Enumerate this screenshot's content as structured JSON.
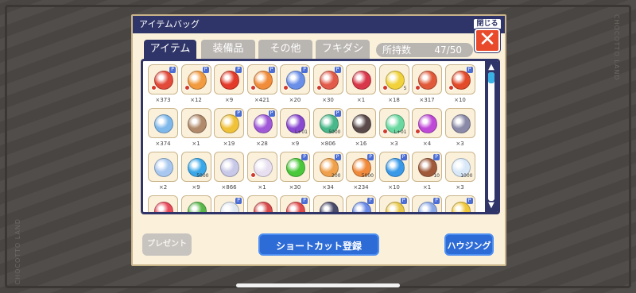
{
  "watermark": "CHOCOTTO LAND",
  "dialog": {
    "title": "アイテムバッグ",
    "close_label": "閉じる",
    "close_symbol": "✕"
  },
  "tabs": [
    {
      "label": "アイテム",
      "active": true
    },
    {
      "label": "装備品",
      "active": false
    },
    {
      "label": "その他",
      "active": false
    },
    {
      "label": "フキダシ",
      "active": false
    }
  ],
  "capacity": {
    "label": "所持数",
    "value": "47/50"
  },
  "scroll": {
    "up": "▲",
    "down": "▼"
  },
  "items": [
    {
      "icon": "red-potion-icon",
      "color": "#e24a3a",
      "qty": "×373",
      "badge": true,
      "minus": true
    },
    {
      "icon": "orange-potion-icon",
      "color": "#f19a3e",
      "qty": "×12",
      "badge": true,
      "minus": true
    },
    {
      "icon": "red-orb-icon",
      "color": "#e33a2a",
      "qty": "×9",
      "badge": true,
      "minus": false
    },
    {
      "icon": "orange-potion-icon",
      "color": "#f08c3a",
      "qty": "×421",
      "badge": true,
      "minus": true
    },
    {
      "icon": "blue-star-potion-icon",
      "color": "#6a8fe8",
      "qty": "×20",
      "badge": true,
      "minus": true
    },
    {
      "icon": "red-potion-icon",
      "color": "#e25a4a",
      "qty": "×30",
      "badge": true,
      "minus": true
    },
    {
      "icon": "red-capsule-icon",
      "color": "#d9384a",
      "qty": "×1",
      "badge": false,
      "minus": false
    },
    {
      "icon": "gold-star-icon",
      "color": "#f1d23a",
      "qty": "×18",
      "badge": false,
      "minus": true,
      "inlabel": "5"
    },
    {
      "icon": "red-bottle-icon",
      "color": "#e05a3a",
      "qty": "×317",
      "badge": false,
      "minus": true
    },
    {
      "icon": "red-orb-icon",
      "color": "#e34a2a",
      "qty": "×10",
      "badge": true,
      "minus": true
    },
    {
      "icon": "blue-crystal-icon",
      "color": "#7fb8ea",
      "qty": "×374",
      "badge": false,
      "minus": false
    },
    {
      "icon": "hammer-icon",
      "color": "#b08a6a",
      "qty": "×1",
      "badge": false,
      "minus": false
    },
    {
      "icon": "gold-orb-icon",
      "color": "#f0c23a",
      "qty": "×19",
      "badge": true,
      "minus": false
    },
    {
      "icon": "purple-orb-icon",
      "color": "#a05ad8",
      "qty": "×28",
      "badge": true,
      "minus": false
    },
    {
      "icon": "purple-gem-icon",
      "color": "#8a4ad0",
      "qty": "×9",
      "badge": false,
      "minus": false,
      "inlabel": "L+01"
    },
    {
      "icon": "green-bottle-icon",
      "color": "#4ab88a",
      "qty": "×806",
      "badge": true,
      "minus": false,
      "inlabel": "5000"
    },
    {
      "icon": "love-heart-icon",
      "color": "#5a4a4a",
      "qty": "×16",
      "badge": false,
      "minus": false
    },
    {
      "icon": "green-moon-icon",
      "color": "#6ad8a0",
      "qty": "×3",
      "badge": false,
      "minus": true,
      "inlabel": "L+01"
    },
    {
      "icon": "rainbow-book-icon",
      "color": "#c04ad8",
      "qty": "×4",
      "badge": false,
      "minus": true
    },
    {
      "icon": "gray-dice-icon",
      "color": "#8a8aa8",
      "qty": "×3",
      "badge": false,
      "minus": false
    },
    {
      "icon": "hp-egg-icon",
      "color": "#a8c8f0",
      "qty": "×2",
      "badge": false,
      "minus": false
    },
    {
      "icon": "blue-drink-icon",
      "color": "#3aa8e8",
      "qty": "×9",
      "badge": false,
      "minus": false,
      "inlabel": "5000"
    },
    {
      "icon": "white-wing-icon",
      "color": "#c8c8e8",
      "qty": "×866",
      "badge": false,
      "minus": false
    },
    {
      "icon": "white-cat-icon",
      "color": "#e8e0f0",
      "qty": "×1",
      "badge": false,
      "minus": true
    },
    {
      "icon": "green-orb-icon",
      "color": "#4ac83a",
      "qty": "×30",
      "badge": true,
      "minus": false
    },
    {
      "icon": "orange-bottle-icon",
      "color": "#f0a04a",
      "qty": "×34",
      "badge": true,
      "minus": false,
      "inlabel": "200"
    },
    {
      "icon": "orange-bottle-icon",
      "color": "#f08a3a",
      "qty": "×234",
      "badge": true,
      "minus": false,
      "inlabel": "5000"
    },
    {
      "icon": "blue-drop-icon",
      "color": "#3a9ae8",
      "qty": "×10",
      "badge": true,
      "minus": false
    },
    {
      "icon": "brown-scroll-icon",
      "color": "#a05a3a",
      "qty": "×1",
      "badge": true,
      "minus": false,
      "inlabel": "10"
    },
    {
      "icon": "milk-bottle-icon",
      "color": "#d8e8f8",
      "qty": "×3",
      "badge": false,
      "minus": false,
      "inlabel": "1000"
    },
    {
      "icon": "flower-icon",
      "color": "#e84a5a",
      "qty": "",
      "badge": false,
      "minus": false
    },
    {
      "icon": "green-leaf-icon",
      "color": "#5ab84a",
      "qty": "",
      "badge": false,
      "minus": false
    },
    {
      "icon": "white-bottle-icon",
      "color": "#e0e8f0",
      "qty": "",
      "badge": true,
      "minus": false
    },
    {
      "icon": "red-box-icon",
      "color": "#d84a4a",
      "qty": "",
      "badge": false,
      "minus": false
    },
    {
      "icon": "red-bottle-icon",
      "color": "#e04a4a",
      "qty": "",
      "badge": true,
      "minus": false
    },
    {
      "icon": "dark-bottle-icon",
      "color": "#4a4a6a",
      "qty": "",
      "badge": false,
      "minus": false
    },
    {
      "icon": "blue-bottle-icon",
      "color": "#6a8ae8",
      "qty": "",
      "badge": true,
      "minus": false
    },
    {
      "icon": "yellow-bottle-icon",
      "color": "#e8c84a",
      "qty": "",
      "badge": true,
      "minus": false
    },
    {
      "icon": "blue-scroll-icon",
      "color": "#8aa8e8",
      "qty": "",
      "badge": true,
      "minus": false
    },
    {
      "icon": "gold-orb-icon",
      "color": "#f0c83a",
      "qty": "",
      "badge": true,
      "minus": false
    }
  ],
  "buttons": {
    "present": "プレゼント",
    "shortcut": "ショートカット登録",
    "housing": "ハウジング"
  }
}
